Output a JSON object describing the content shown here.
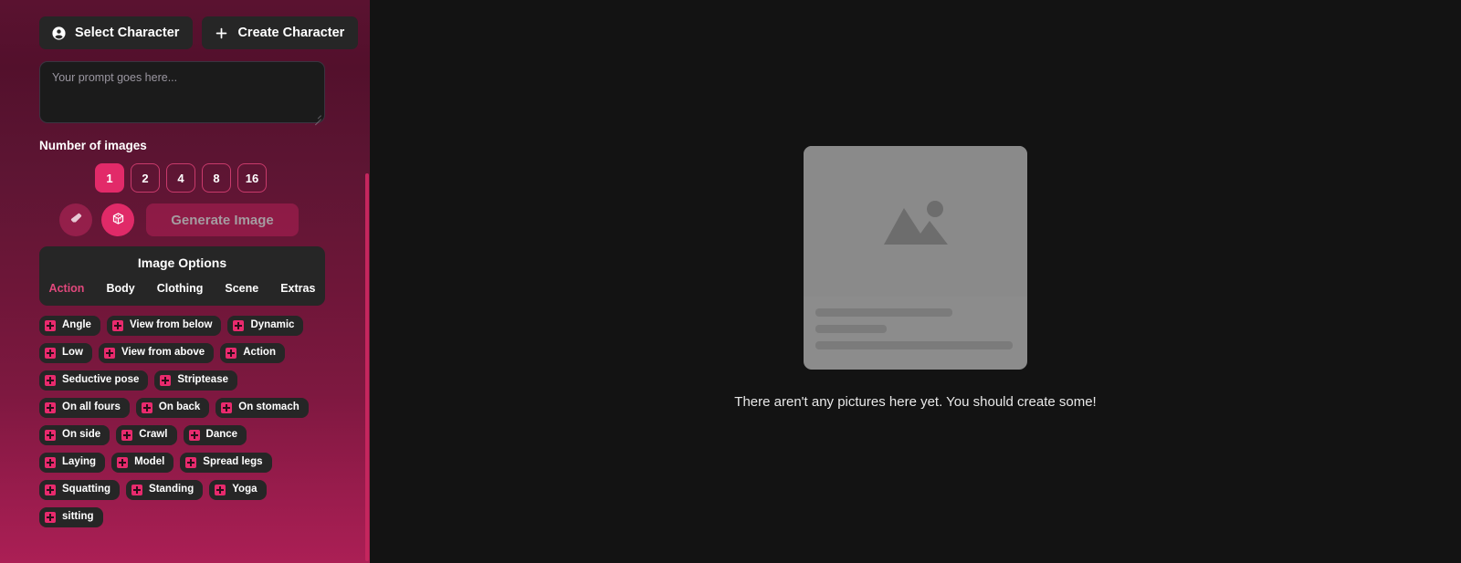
{
  "left_panel": {
    "character_buttons": [
      {
        "label": "Select Character",
        "icon": "account-circle-icon"
      },
      {
        "label": "Create Character",
        "icon": "plus-icon"
      }
    ],
    "prompt": {
      "value": "",
      "placeholder": "Your prompt goes here..."
    },
    "number_of_images": {
      "label": "Number of images",
      "options": [
        "1",
        "2",
        "4",
        "8",
        "16"
      ],
      "selected": "1"
    },
    "actions": {
      "eraser_icon": "eraser-icon",
      "dice_icon": "dice-icon",
      "generate_label": "Generate Image"
    },
    "image_options": {
      "title": "Image Options",
      "tabs": [
        "Action",
        "Body",
        "Clothing",
        "Scene",
        "Extras"
      ],
      "active_tab": "Action",
      "tag_rows": [
        [
          "Angle",
          "View from below",
          "Dynamic"
        ],
        [
          "Low",
          "View from above",
          "Action"
        ],
        [
          "Seductive pose",
          "Striptease"
        ],
        [
          "On all fours",
          "On back",
          "On stomach"
        ],
        [
          "On side",
          "Crawl",
          "Dance"
        ],
        [
          "Laying",
          "Model",
          "Spread legs"
        ],
        [
          "Squatting",
          "Standing",
          "Yoga"
        ],
        [
          "sitting"
        ]
      ]
    }
  },
  "right_pane": {
    "empty_state_text": "There aren't any pictures here yet. You should create some!",
    "placeholder_icon": "image-placeholder-icon"
  },
  "colors": {
    "accent_pink": "#e22a69",
    "panel_dark": "#262626",
    "background_dark": "#131313",
    "tab_active": "#e0487c"
  }
}
